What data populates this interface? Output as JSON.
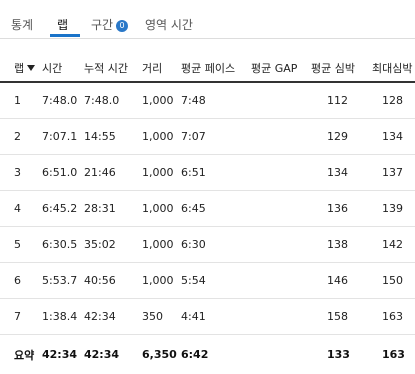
{
  "tabs": [
    {
      "label": "통계",
      "active": false
    },
    {
      "label": "랩",
      "active": true
    },
    {
      "label": "구간",
      "active": false,
      "badge": "0"
    },
    {
      "label": "영역 시간",
      "active": false
    }
  ],
  "table": {
    "columns": [
      "랩",
      "시간",
      "누적 시간",
      "거리",
      "평균 페이스",
      "평균 GAP",
      "평균 심박",
      "최대심박"
    ],
    "sort_column": "랩",
    "rows": [
      [
        "1",
        "7:48.0",
        "7:48.0",
        "1,000",
        "7:48",
        "",
        "112",
        "128"
      ],
      [
        "2",
        "7:07.1",
        "14:55",
        "1,000",
        "7:07",
        "",
        "129",
        "134"
      ],
      [
        "3",
        "6:51.0",
        "21:46",
        "1,000",
        "6:51",
        "",
        "134",
        "137"
      ],
      [
        "4",
        "6:45.2",
        "28:31",
        "1,000",
        "6:45",
        "",
        "136",
        "139"
      ],
      [
        "5",
        "6:30.5",
        "35:02",
        "1,000",
        "6:30",
        "",
        "138",
        "142"
      ],
      [
        "6",
        "5:53.7",
        "40:56",
        "1,000",
        "5:54",
        "",
        "146",
        "150"
      ],
      [
        "7",
        "1:38.4",
        "42:34",
        "350",
        "4:41",
        "",
        "158",
        "163"
      ]
    ],
    "summary": [
      "요약",
      "42:34",
      "42:34",
      "6,350",
      "6:42",
      "",
      "133",
      "163"
    ]
  },
  "colors": {
    "accent": "#1a73c9",
    "badge": "#2a78c8",
    "text": "#222222",
    "row_divider": "#e3e3e3"
  },
  "icons": {
    "sort": "sort-down-arrow-icon"
  }
}
